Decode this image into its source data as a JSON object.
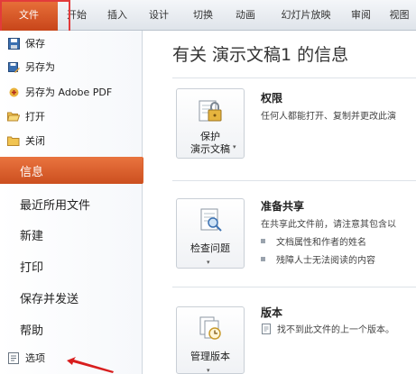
{
  "ribbon": {
    "tabs": [
      "文件",
      "开始",
      "插入",
      "设计",
      "切换",
      "动画",
      "幻灯片放映",
      "审阅",
      "视图"
    ],
    "active_color": "#d9602c"
  },
  "sidebar": {
    "small_items": [
      {
        "label": "保存",
        "icon": "save-icon"
      },
      {
        "label": "另存为",
        "icon": "save-as-icon"
      },
      {
        "label": "另存为 Adobe PDF",
        "icon": "pdf-icon"
      },
      {
        "label": "打开",
        "icon": "open-folder-icon"
      },
      {
        "label": "关闭",
        "icon": "close-folder-icon"
      }
    ],
    "selected": "信息",
    "big_items": [
      "最近所用文件",
      "新建",
      "打印",
      "保存并发送",
      "帮助"
    ],
    "options": {
      "label": "选项",
      "icon": "options-icon"
    }
  },
  "main": {
    "title": "有关 演示文稿1 的信息",
    "sections": [
      {
        "button_lines": [
          "保护",
          "演示文稿"
        ],
        "icon": "lock-icon",
        "title": "权限",
        "desc": "任何人都能打开、复制并更改此演"
      },
      {
        "button_lines": [
          "检查问题"
        ],
        "icon": "inspect-icon",
        "title": "准备共享",
        "desc": "在共享此文件前，请注意其包含以",
        "bullets": [
          "文档属性和作者的姓名",
          "残障人士无法阅读的内容"
        ]
      },
      {
        "button_lines": [
          "管理版本"
        ],
        "icon": "versions-icon",
        "title": "版本",
        "desc": "找不到此文件的上一个版本。"
      }
    ]
  }
}
